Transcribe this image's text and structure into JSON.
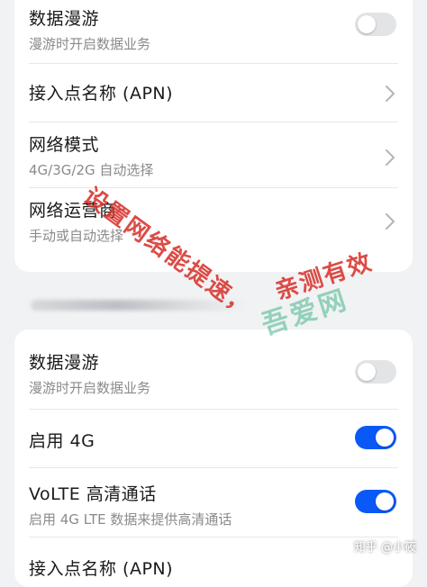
{
  "section1": {
    "roaming": {
      "title": "数据漫游",
      "subtitle": "漫游时开启数据业务",
      "enabled": false
    },
    "apn": {
      "title": "接入点名称 (APN)"
    },
    "network_mode": {
      "title": "网络模式",
      "subtitle": "4G/3G/2G 自动选择"
    },
    "operator": {
      "title": "网络运营商",
      "subtitle": "手动或自动选择"
    }
  },
  "section2": {
    "roaming": {
      "title": "数据漫游",
      "subtitle": "漫游时开启数据业务",
      "enabled": false
    },
    "enable_4g": {
      "title": "启用 4G",
      "enabled": true
    },
    "volte": {
      "title": "VoLTE 高清通话",
      "subtitle": "启用 4G LTE 数据来提供高清通话",
      "enabled": true
    },
    "apn": {
      "title": "接入点名称 (APN)"
    }
  },
  "watermark": {
    "line1": "设置网络能提速，",
    "line2": "亲测有效",
    "site": "吾爱网",
    "credit": "知乎 @小筱"
  },
  "colors": {
    "accent": "#0a59f7",
    "watermark_red": "#d8342d"
  }
}
